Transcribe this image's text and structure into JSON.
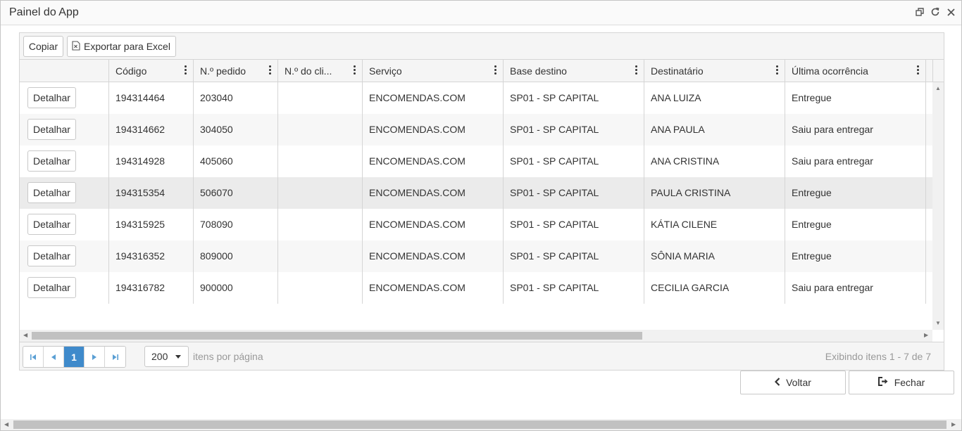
{
  "window": {
    "title": "Painel do App"
  },
  "toolbar": {
    "copy_label": "Copiar",
    "export_label": "Exportar para Excel"
  },
  "columns": [
    "",
    "Código",
    "N.º pedido",
    "N.º do cli...",
    "Serviço",
    "Base destino",
    "Destinatário",
    "Última ocorrência"
  ],
  "rows": [
    {
      "action": "Detalhar",
      "codigo": "194314464",
      "pedido": "203040",
      "cliente": "",
      "servico": "ENCOMENDAS.COM",
      "base": "SP01 - SP CAPITAL",
      "destinatario": "ANA LUIZA",
      "ocorrencia": "Entregue"
    },
    {
      "action": "Detalhar",
      "codigo": "194314662",
      "pedido": "304050",
      "cliente": "",
      "servico": "ENCOMENDAS.COM",
      "base": "SP01 - SP CAPITAL",
      "destinatario": "ANA PAULA",
      "ocorrencia": "Saiu para entregar"
    },
    {
      "action": "Detalhar",
      "codigo": "194314928",
      "pedido": "405060",
      "cliente": "",
      "servico": "ENCOMENDAS.COM",
      "base": "SP01 - SP CAPITAL",
      "destinatario": "ANA CRISTINA",
      "ocorrencia": "Saiu para entregar"
    },
    {
      "action": "Detalhar",
      "codigo": "194315354",
      "pedido": "506070",
      "cliente": "",
      "servico": "ENCOMENDAS.COM",
      "base": "SP01 - SP CAPITAL",
      "destinatario": "PAULA CRISTINA",
      "ocorrencia": "Entregue"
    },
    {
      "action": "Detalhar",
      "codigo": "194315925",
      "pedido": "708090",
      "cliente": "",
      "servico": "ENCOMENDAS.COM",
      "base": "SP01 - SP CAPITAL",
      "destinatario": "KÁTIA CILENE",
      "ocorrencia": "Entregue"
    },
    {
      "action": "Detalhar",
      "codigo": "194316352",
      "pedido": "809000",
      "cliente": "",
      "servico": "ENCOMENDAS.COM",
      "base": "SP01 - SP CAPITAL",
      "destinatario": "SÔNIA MARIA",
      "ocorrencia": "Entregue"
    },
    {
      "action": "Detalhar",
      "codigo": "194316782",
      "pedido": "900000",
      "cliente": "",
      "servico": "ENCOMENDAS.COM",
      "base": "SP01 - SP CAPITAL",
      "destinatario": "CECILIA GARCIA",
      "ocorrencia": "Saiu para entregar"
    }
  ],
  "pager": {
    "current_page": "1",
    "page_size": "200",
    "page_size_label": "itens por página",
    "info": "Exibindo itens 1 - 7 de 7"
  },
  "actions": {
    "back_label": "Voltar",
    "close_label": "Fechar"
  },
  "colors": {
    "accent": "#3f8acb",
    "header_bg": "#f5f5f5",
    "border": "#d5d5d5"
  }
}
